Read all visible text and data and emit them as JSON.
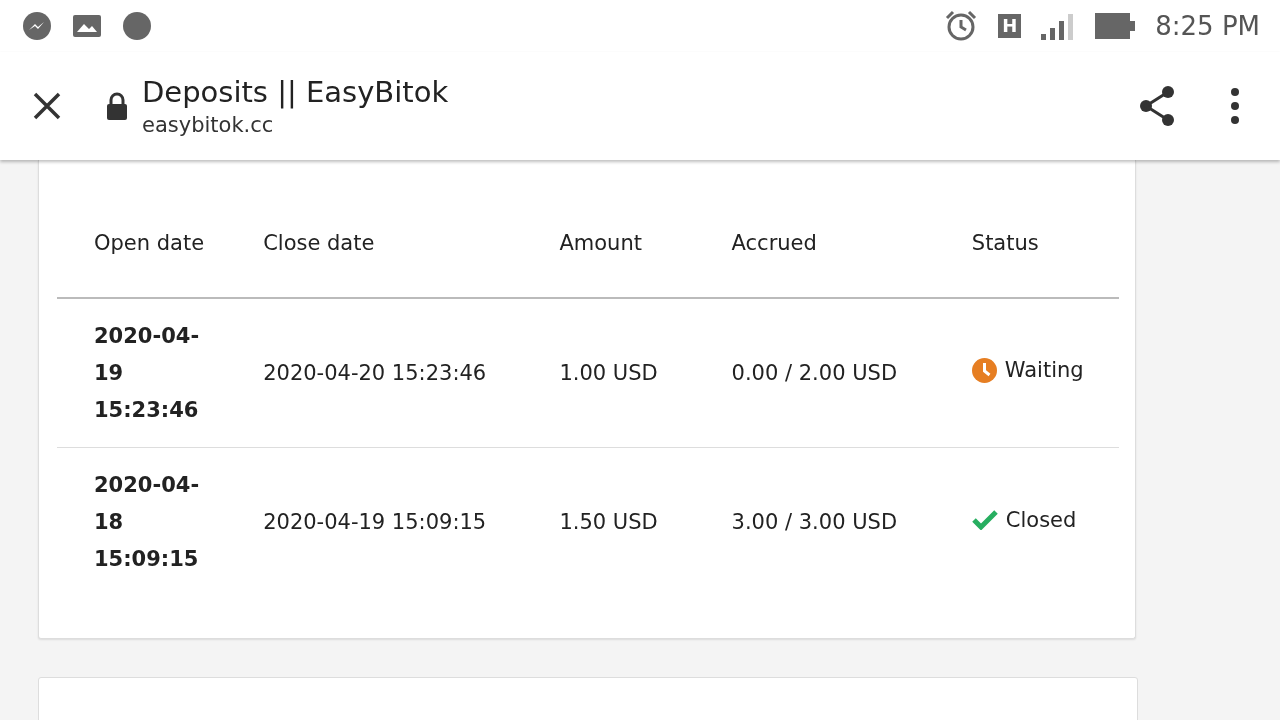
{
  "status_bar": {
    "time": "8:25 PM",
    "network": "H"
  },
  "toolbar": {
    "title": "Deposits || EasyBitok",
    "url": "easybitok.cc"
  },
  "table": {
    "columns": [
      "Open date",
      "Close date",
      "Amount",
      "Accrued",
      "Status"
    ],
    "rows": [
      {
        "open_date": "2020-04-19 15:23:46",
        "close_date": "2020-04-20 15:23:46",
        "amount": "1.00 USD",
        "accrued": "0.00 / 2.00 USD",
        "status": {
          "kind": "waiting",
          "label": "Waiting"
        }
      },
      {
        "open_date": "2020-04-18 15:09:15",
        "close_date": "2020-04-19 15:09:15",
        "amount": "1.50 USD",
        "accrued": "3.00 / 3.00 USD",
        "status": {
          "kind": "closed",
          "label": "Closed"
        }
      }
    ]
  }
}
